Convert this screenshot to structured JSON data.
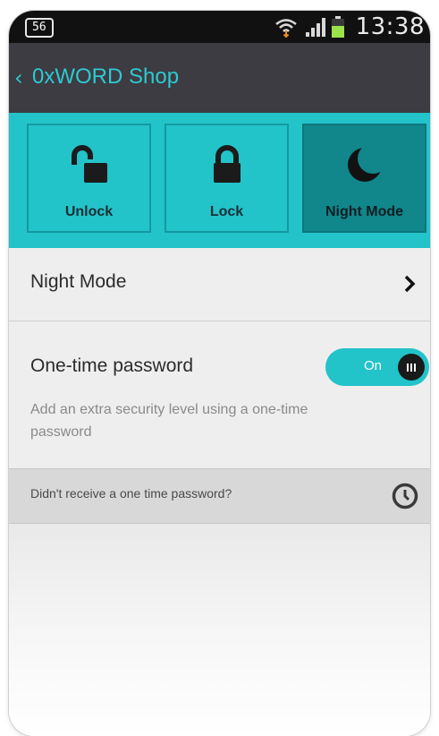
{
  "status_bar": {
    "badge": "56",
    "time": "13:38",
    "icons": [
      "wifi-icon",
      "signal-icon",
      "battery-icon"
    ],
    "battery_color": "#9be34a"
  },
  "action_bar": {
    "back_glyph": "‹",
    "title": "0xWORD Shop",
    "title_color": "#2ec9d1"
  },
  "tiles": [
    {
      "label": "Unlock",
      "icon": "unlock-icon",
      "active": false
    },
    {
      "label": "Lock",
      "icon": "lock-icon",
      "active": false
    },
    {
      "label": "Night Mode",
      "icon": "moon-icon",
      "active": true
    }
  ],
  "night_mode_row": {
    "label": "Night Mode",
    "icon": "chevron-right-icon"
  },
  "otp": {
    "title": "One-time password",
    "toggle_label": "On",
    "toggle_state": "on",
    "description": "Add an extra security level using a one-time password"
  },
  "resend_row": {
    "label": "Didn't receive a one time password?",
    "icon": "clock-icon"
  },
  "colors": {
    "accent": "#22c3c9",
    "active_tile": "#11868b",
    "action_bar": "#3c3c42"
  }
}
